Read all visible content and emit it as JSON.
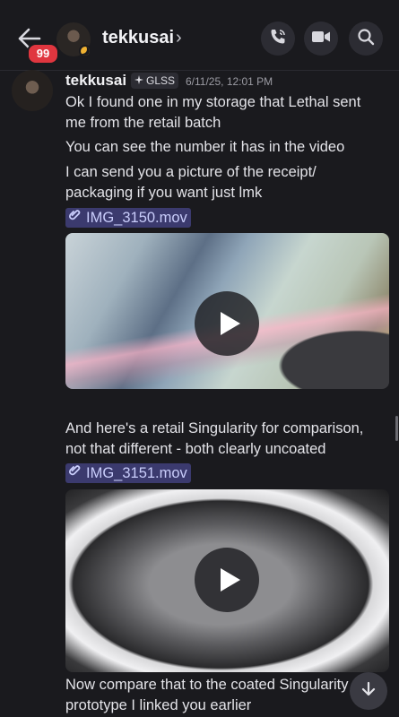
{
  "header": {
    "unread_count": "99",
    "channel_name": "tekkusai",
    "chevron": "›",
    "icons": [
      "back-arrow-icon",
      "call-icon",
      "video-call-icon",
      "search-icon"
    ]
  },
  "message": {
    "author": "tekkusai",
    "tag": "GLSS",
    "timestamp": "6/11/25, 12:01 PM",
    "lines_a": [
      "Ok I found one in my storage that Lethal sent",
      "me from the retail batch"
    ],
    "lines_b": [
      "You can see the number it has in the video"
    ],
    "lines_c": [
      "I can send you a picture of the receipt/",
      "packaging if you want just lmk"
    ],
    "attachment_1": "IMG_3150.mov",
    "lines_d": [
      "And here's a retail Singularity for comparison,",
      "not that different - both clearly uncoated"
    ],
    "attachment_2": "IMG_3151.mov",
    "lines_e": [
      "Now compare that to the coated Singularity",
      "prototype I linked you earlier"
    ]
  },
  "colors": {
    "background": "#1a1a1e",
    "badge": "#e0363f",
    "attachment_bg": "#3b3a6e",
    "attachment_text": "#c9cdfb"
  }
}
